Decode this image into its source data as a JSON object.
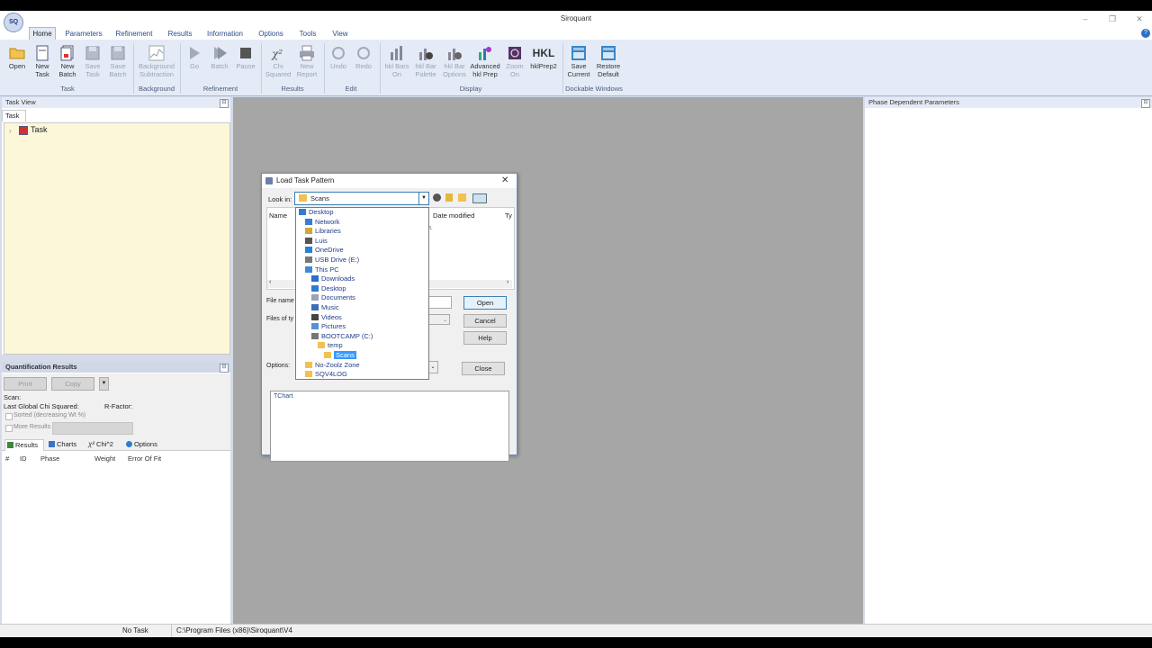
{
  "app": {
    "title": "Siroquant",
    "logo_text": "SQ",
    "window_controls": [
      "–",
      "❐",
      "✕"
    ]
  },
  "ribbon": {
    "tabs": [
      {
        "label": "Home",
        "active": true
      },
      {
        "label": "Parameters"
      },
      {
        "label": "Refinement"
      },
      {
        "label": "Results"
      },
      {
        "label": "Information"
      },
      {
        "label": "Options"
      },
      {
        "label": "Tools"
      },
      {
        "label": "View"
      }
    ],
    "groups": {
      "task": "Task",
      "background": "Background",
      "refinement": "Refinement",
      "results": "Results",
      "edit": "Edit",
      "display": "Display",
      "dockable": "Dockable Windows"
    },
    "buttons": {
      "open": "Open",
      "new_task": "New Task",
      "new_batch": "New Batch",
      "save_task": "Save Task",
      "save_batch": "Save Batch",
      "background_subtraction": "Background Subtraction",
      "go": "Go",
      "batch": "Batch",
      "pause": "Pause",
      "chi_squared": "Chi Squared",
      "new_report": "New Report",
      "undo": "Undo",
      "redo": "Redo",
      "hkl_bars_on": "hkl Bars On",
      "hkl_bar_palette": "hkl Bar Palette",
      "hkl_bar_options": "hkl Bar Options",
      "advanced_hkl_prep": "Advanced hkl Prep",
      "zoom_on": "Zoom On",
      "hklprep2": "hklPrep2",
      "hkl_icon_text": "HKL",
      "save_current": "Save Current",
      "restore_default": "Restore Default"
    }
  },
  "task_view": {
    "title": "Task View",
    "tab": "Task",
    "tree_root": "Task"
  },
  "quant": {
    "title": "Quantification Results",
    "print": "Print",
    "copy": "Copy",
    "scan_label": "Scan:",
    "chi_label": "Last Global Chi Squared:",
    "rfactor_label": "R-Factor:",
    "sorted_label": "Sorted (decreasing Wt %)",
    "more_results": "More Results",
    "tabs": [
      "Results",
      "Charts",
      "Chi^2",
      "Options"
    ],
    "columns": [
      "#",
      "ID",
      "Phase",
      "Weight",
      "Error Of Fit"
    ]
  },
  "right_panel": {
    "title": "Phase Dependent Parameters"
  },
  "statusbar": {
    "task": "No Task",
    "path": "C:\\Program Files (x86)\\Siroquant\\V4"
  },
  "dialog": {
    "title": "Load Task Pattern",
    "look_in_label": "Look in:",
    "look_in_value": "Scans",
    "col_name": "Name",
    "col_date": "Date modified",
    "col_type": "Ty",
    "file_name_label": "File name",
    "files_type_label": "Files of ty",
    "options_label": "Options:",
    "open_btn": "Open",
    "cancel_btn": "Cancel",
    "help_btn": "Help",
    "close_btn": "Close",
    "tchart": "TChart",
    "stray_text": "h.",
    "dropdown": [
      {
        "label": "Desktop",
        "indent": 0,
        "icon": "desktop"
      },
      {
        "label": "Network",
        "indent": 1,
        "icon": "network"
      },
      {
        "label": "Libraries",
        "indent": 1,
        "icon": "library"
      },
      {
        "label": "Luis",
        "indent": 1,
        "icon": "user"
      },
      {
        "label": "OneDrive",
        "indent": 1,
        "icon": "cloud"
      },
      {
        "label": "USB Drive (E:)",
        "indent": 1,
        "icon": "drive"
      },
      {
        "label": "This PC",
        "indent": 1,
        "icon": "pc"
      },
      {
        "label": "Downloads",
        "indent": 2,
        "icon": "download"
      },
      {
        "label": "Desktop",
        "indent": 2,
        "icon": "desktop"
      },
      {
        "label": "Documents",
        "indent": 2,
        "icon": "doc"
      },
      {
        "label": "Music",
        "indent": 2,
        "icon": "music"
      },
      {
        "label": "Videos",
        "indent": 2,
        "icon": "video"
      },
      {
        "label": "Pictures",
        "indent": 2,
        "icon": "picture"
      },
      {
        "label": "BOOTCAMP (C:)",
        "indent": 2,
        "icon": "drive"
      },
      {
        "label": "temp",
        "indent": 3,
        "icon": "folder"
      },
      {
        "label": "Scans",
        "indent": 4,
        "icon": "folder",
        "selected": true
      },
      {
        "label": "No-Zoolz Zone",
        "indent": 1,
        "icon": "folder"
      },
      {
        "label": "SQV4LOG",
        "indent": 1,
        "icon": "folder"
      }
    ]
  },
  "colors": {
    "ribbon_bg": "#e4ebf6",
    "accent": "#2a4b8d",
    "selection": "#3399ff",
    "task_area": "#fbf7d8"
  }
}
